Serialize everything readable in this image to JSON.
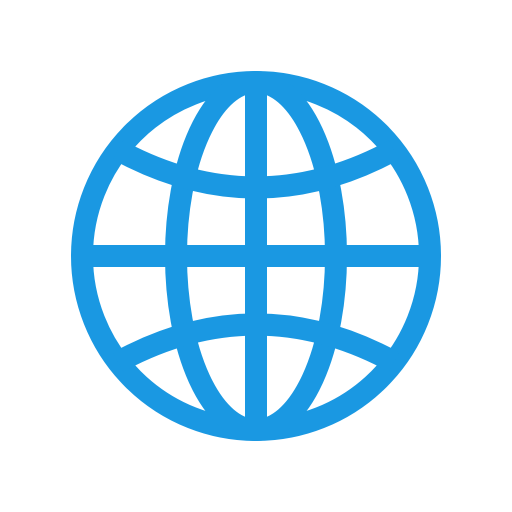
{
  "icon": {
    "name": "globe-icon",
    "color": "#1a98e2",
    "background": "#ffffff"
  }
}
